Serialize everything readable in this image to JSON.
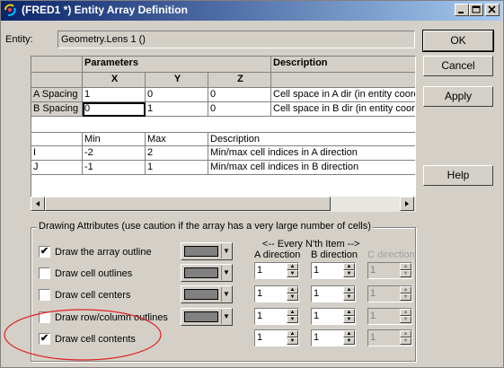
{
  "window": {
    "title": "(FRED1 *) Entity Array Definition",
    "controls": [
      "_",
      "□",
      "×"
    ]
  },
  "entity": {
    "label": "Entity:",
    "value": "Geometry.Lens 1    ()"
  },
  "buttons": {
    "ok": "OK",
    "cancel": "Cancel",
    "apply": "Apply",
    "help": "Help"
  },
  "spacing_table": {
    "header_parameters": "Parameters",
    "header_description": "Description",
    "columns": [
      "X",
      "Y",
      "Z"
    ],
    "rows": [
      {
        "label": "A Spacing",
        "x": "1",
        "y": "0",
        "z": "0",
        "desc": "Cell space in A dir (in entity coord"
      },
      {
        "label": "B Spacing",
        "x": "0",
        "y": "1",
        "z": "0",
        "desc": "Cell space in B dir (in entity coord"
      }
    ]
  },
  "index_table": {
    "columns": [
      "Min",
      "Max",
      "Description"
    ],
    "rows": [
      {
        "label": "I",
        "min": "-2",
        "max": "2",
        "desc": "Min/max cell indices in A direction"
      },
      {
        "label": "J",
        "min": "-1",
        "max": "1",
        "desc": "Min/max cell indices in B direction"
      }
    ]
  },
  "drawing": {
    "group_title": "Drawing Attributes (use caution if the array has a very large number of cells)",
    "every_nth": "<-- Every N'th Item -->",
    "dir_a": "A direction",
    "dir_b": "B direction",
    "dir_c": "C direction",
    "options": [
      {
        "label": "Draw the array outline",
        "checked": true,
        "check_mark": "✔",
        "a": "1",
        "b": "1",
        "c": "1"
      },
      {
        "label": "Draw cell outlines",
        "checked": false,
        "check_mark": "",
        "a": "1",
        "b": "1",
        "c": "1"
      },
      {
        "label": "Draw cell centers",
        "checked": false,
        "check_mark": "",
        "a": "1",
        "b": "1",
        "c": "1"
      },
      {
        "label": "Draw row/column outlines",
        "checked": false,
        "check_mark": "",
        "a": "1",
        "b": "1",
        "c": "1"
      },
      {
        "label": "Draw cell contents",
        "checked": true,
        "check_mark": "✔",
        "a": "1",
        "b": "1",
        "c": "1"
      }
    ],
    "swatch_color": "#808080"
  },
  "annotation": {
    "ellipse_color": "#e02020"
  }
}
